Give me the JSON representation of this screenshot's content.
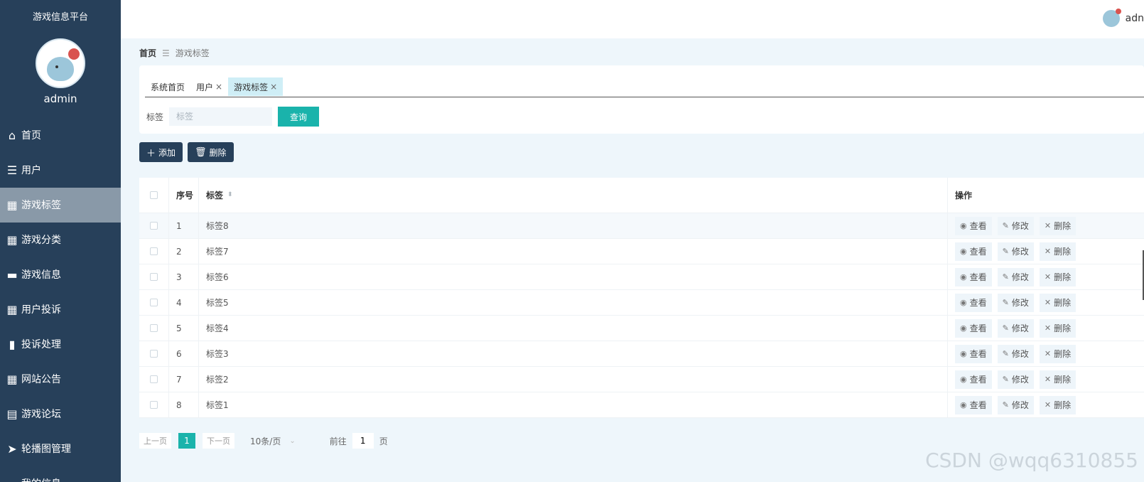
{
  "sidebar": {
    "brand": "游戏信息平台",
    "username": "admin",
    "items": [
      {
        "label": "首页",
        "icon": "home-icon",
        "active": false
      },
      {
        "label": "用户",
        "icon": "sliders-icon",
        "active": false
      },
      {
        "label": "游戏标签",
        "icon": "grid-icon",
        "active": true
      },
      {
        "label": "游戏分类",
        "icon": "grid-icon",
        "active": false
      },
      {
        "label": "游戏信息",
        "icon": "briefcase-icon",
        "active": false
      },
      {
        "label": "用户投诉",
        "icon": "grid-icon",
        "active": false
      },
      {
        "label": "投诉处理",
        "icon": "book-icon",
        "active": false
      },
      {
        "label": "网站公告",
        "icon": "apps-icon",
        "active": false
      },
      {
        "label": "游戏论坛",
        "icon": "clipboard-icon",
        "active": false
      },
      {
        "label": "轮播图管理",
        "icon": "send-icon",
        "active": false
      },
      {
        "label": "我的信息",
        "icon": "id-card-icon",
        "active": false
      }
    ]
  },
  "topbar": {
    "user": "adn"
  },
  "breadcrumb": {
    "home": "首页",
    "current": "游戏标签"
  },
  "tabs": [
    {
      "label": "系统首页",
      "closable": false,
      "active": false
    },
    {
      "label": "用户",
      "closable": true,
      "active": false
    },
    {
      "label": "游戏标签",
      "closable": true,
      "active": true
    }
  ],
  "filter": {
    "label": "标签",
    "placeholder": "标签",
    "query_button": "查询"
  },
  "actions": {
    "add": "添加",
    "delete": "删除"
  },
  "table": {
    "headers": {
      "index": "序号",
      "tag": "标签",
      "ops": "操作"
    },
    "rows": [
      {
        "index": "1",
        "tag": "标签8"
      },
      {
        "index": "2",
        "tag": "标签7"
      },
      {
        "index": "3",
        "tag": "标签6"
      },
      {
        "index": "4",
        "tag": "标签5"
      },
      {
        "index": "5",
        "tag": "标签4"
      },
      {
        "index": "6",
        "tag": "标签3"
      },
      {
        "index": "7",
        "tag": "标签2"
      },
      {
        "index": "8",
        "tag": "标签1"
      }
    ],
    "ops": {
      "view": "查看",
      "edit": "修改",
      "delete": "删除"
    }
  },
  "pager": {
    "prev": "上一页",
    "page": "1",
    "next": "下一页",
    "size": "10条/页",
    "goto_prefix": "前往",
    "goto_value": "1",
    "goto_suffix": "页"
  },
  "watermark": "CSDN @wqq6310855",
  "colors": {
    "sidebar": "#27405a",
    "accent": "#1ab3ab",
    "active_item": "#8999a8"
  }
}
